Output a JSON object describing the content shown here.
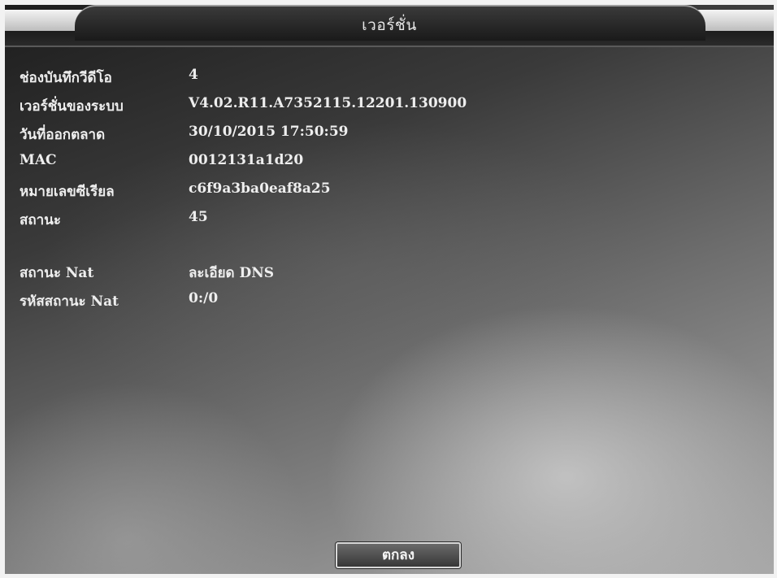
{
  "window": {
    "title": "เวอร์ชั่น"
  },
  "info": {
    "rows": [
      {
        "label": "ช่องบันทึกวีดีโอ",
        "value": "4"
      },
      {
        "label": "เวอร์ชั่นของระบบ",
        "value": "V4.02.R11.A7352115.12201.130900"
      },
      {
        "label": "วันที่ออกตลาด",
        "value": "30/10/2015 17:50:59"
      },
      {
        "label": "MAC",
        "value": "0012131a1d20"
      },
      {
        "label": "หมายเลขซีเรียล",
        "value": "c6f9a3ba0eaf8a25"
      },
      {
        "label": "สถานะ",
        "value": "45"
      }
    ],
    "nat_rows": [
      {
        "label": "สถานะ Nat",
        "value": "ละเอียด DNS"
      },
      {
        "label": "รหัสสถานะ Nat",
        "value": "0:/0"
      }
    ]
  },
  "buttons": {
    "ok_label": "ตกลง"
  }
}
